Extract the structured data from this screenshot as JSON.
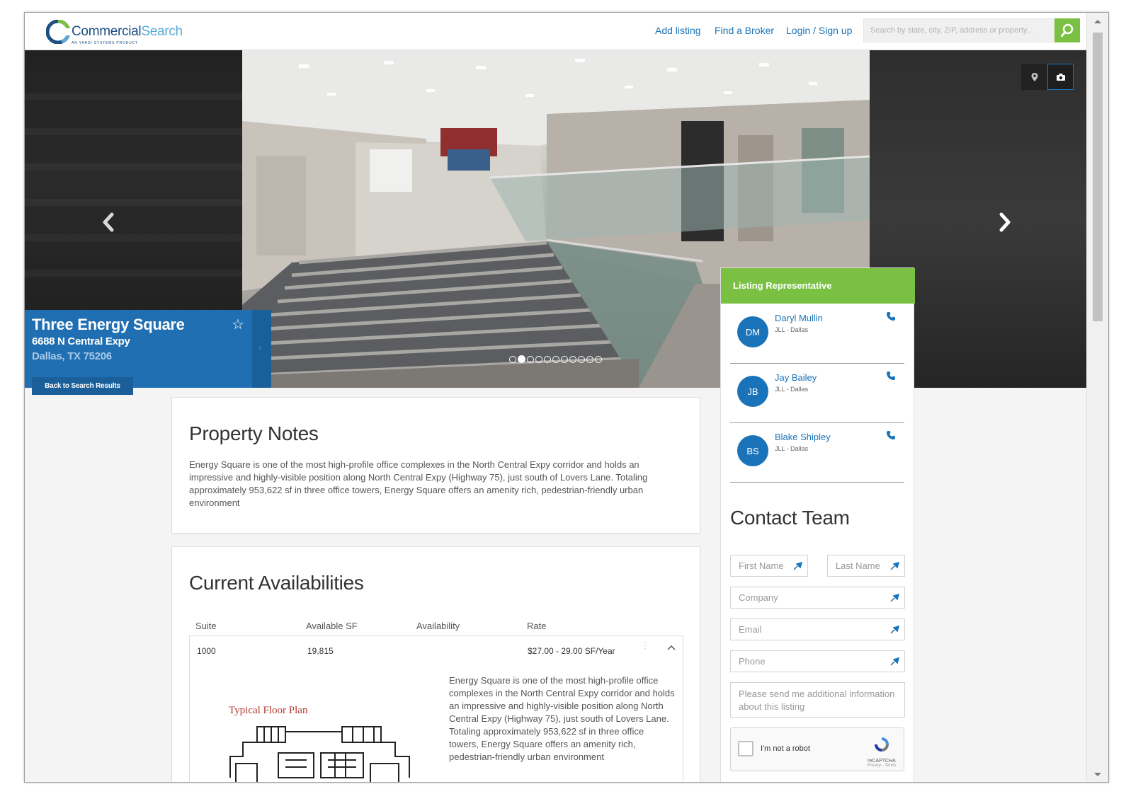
{
  "header": {
    "logo": {
      "text_a": "Commercial",
      "text_b": "Search",
      "tagline": "AN YARDI SYSTEMS PRODUCT"
    },
    "nav": {
      "add_listing": "Add listing",
      "find_broker": "Find a Broker",
      "login": "Login / Sign up"
    },
    "search": {
      "placeholder": "Search by state, city, ZIP, address or property..."
    }
  },
  "hero": {
    "slide_count": 11,
    "active_slide": 1,
    "tools": [
      "map-pin-icon",
      "camera-icon"
    ]
  },
  "property": {
    "name": "Three Energy Square",
    "address_line1": "6688 N Central Expy",
    "address_line2": "Dallas, TX 75206",
    "back_label": "Back to Search Results"
  },
  "notes": {
    "title": "Property Notes",
    "body": "Energy Square is one of the most high-profile office complexes in the North Central Expy corridor and holds an impressive and highly-visible position along North Central Expy (Highway 75), just south of Lovers Lane. Totaling approximately 953,622 sf in three office towers, Energy Square offers an amenity rich, pedestrian-friendly urban environment"
  },
  "availabilities": {
    "title": "Current Availabilities",
    "columns": [
      "Suite",
      "Available SF",
      "Availability",
      "Rate"
    ],
    "rows": [
      {
        "suite": "1000",
        "sf": "19,815",
        "availability": "",
        "rate": "$27.00 - 29.00 SF/Year"
      }
    ],
    "detail_text": "Energy Square is one of the most high-profile office complexes in the North Central Expy corridor and holds an impressive and highly-visible position along North Central Expy (Highway 75), just south of Lovers Lane. Totaling approximately 953,622 sf in three office towers, Energy Square offers an amenity rich, pedestrian-friendly urban environment",
    "floor_plan_title": "Typical Floor Plan"
  },
  "representatives": {
    "title": "Listing Representative",
    "items": [
      {
        "initials": "DM",
        "name": "Daryl Mullin",
        "company": "JLL - Dallas"
      },
      {
        "initials": "JB",
        "name": "Jay Bailey",
        "company": "JLL - Dallas"
      },
      {
        "initials": "BS",
        "name": "Blake Shipley",
        "company": "JLL - Dallas"
      }
    ]
  },
  "contact": {
    "title": "Contact Team",
    "first_name": "First Name",
    "last_name": "Last Name",
    "company": "Company",
    "email": "Email",
    "phone": "Phone",
    "message": "Please send me additional information about this listing",
    "captcha_label": "I'm not a robot",
    "captcha_brand": "reCAPTCHA",
    "captcha_terms": "Privacy - Terms"
  },
  "colors": {
    "brand_blue": "#1a73b8",
    "brand_green": "#7ac143",
    "title_card": "#1f6fb2"
  }
}
